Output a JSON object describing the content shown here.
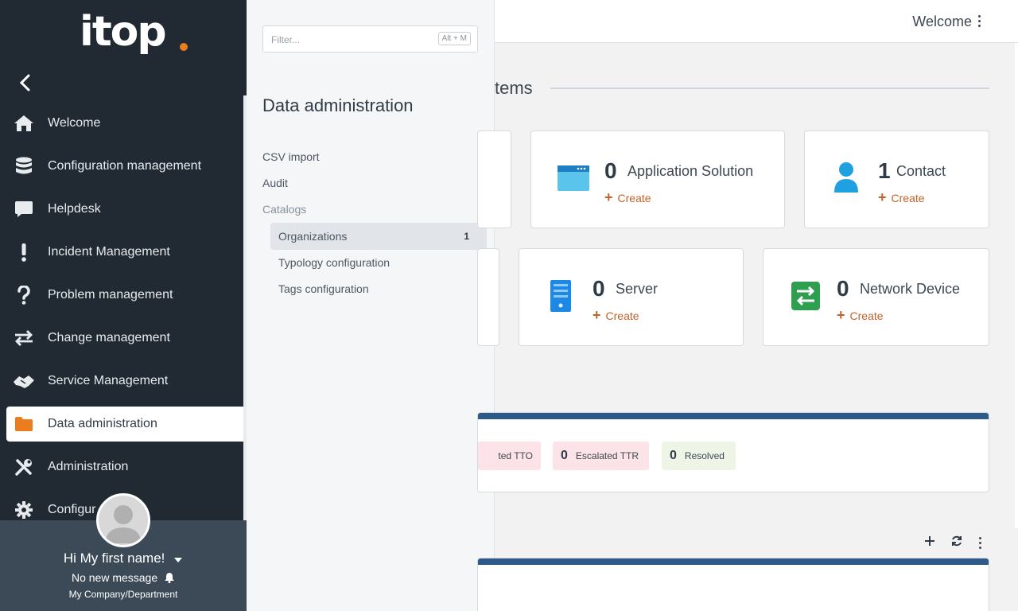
{
  "nav": {
    "logo": "itop",
    "collapse_icon": "chevron-left-icon",
    "items": [
      {
        "label": "Welcome",
        "icon": "house-icon"
      },
      {
        "label": "Configuration management",
        "icon": "database-icon"
      },
      {
        "label": "Helpdesk",
        "icon": "speech-bubble-icon"
      },
      {
        "label": "Incident Management",
        "icon": "exclamation-icon"
      },
      {
        "label": "Problem management",
        "icon": "question-icon"
      },
      {
        "label": "Change management",
        "icon": "arrows-exchange-icon"
      },
      {
        "label": "Service Management",
        "icon": "handshake-icon"
      },
      {
        "label": "Data administration",
        "icon": "folder-icon",
        "active": true
      },
      {
        "label": "Administration",
        "icon": "tools-icon"
      },
      {
        "label": "Configur",
        "icon": "gear-icon"
      }
    ],
    "user": {
      "name": "Hi My first name!",
      "messages": "No new message",
      "org": "My Company/Department"
    }
  },
  "flyout": {
    "filter_placeholder": "Filter...",
    "filter_shortcut": "Alt + M",
    "title": "Data administration",
    "links": [
      "CSV import",
      "Audit"
    ],
    "group": "Catalogs",
    "subitems": [
      {
        "label": "Organizations",
        "count": "1"
      },
      {
        "label": "Typology configuration"
      },
      {
        "label": "Tags configuration"
      }
    ]
  },
  "topbar": {
    "welcome": "Welcome"
  },
  "main": {
    "section_title": "tems",
    "cards": [
      {
        "count": "0",
        "name": "Application Solution",
        "create": "Create",
        "icon": "app-window-icon"
      },
      {
        "count": "1",
        "name": "Contact",
        "create": "Create",
        "icon": "person-icon"
      },
      {
        "count": "0",
        "name": "Server",
        "create": "Create",
        "icon": "server-icon"
      },
      {
        "count": "0",
        "name": "Network Device",
        "create": "Create",
        "icon": "network-device-icon"
      }
    ],
    "pills": [
      {
        "count": "",
        "label": "ted TTO",
        "color": "#fbe3e7"
      },
      {
        "count": "0",
        "label": "Escalated TTR",
        "color": "#fbe3e7"
      },
      {
        "count": "0",
        "label": "Resolved",
        "color": "#eef5e6"
      }
    ],
    "toolbar_icons": [
      "plus-icon",
      "refresh-icon",
      "kebab-icon"
    ],
    "colors": {
      "accent": "#c0632a",
      "panel_header": "#2e5a8a",
      "nav_bg": "#212933",
      "logo_dot": "#ea7d1e"
    }
  }
}
